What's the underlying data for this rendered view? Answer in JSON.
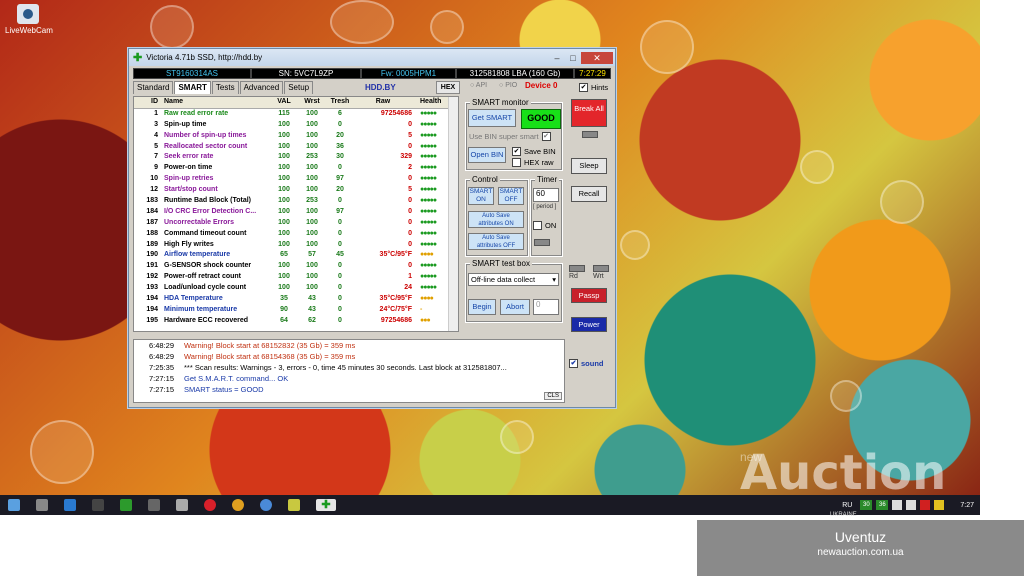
{
  "desktop": {
    "icon_label": "LiveWebCam"
  },
  "window": {
    "title": "Victoria 4.71b SSD, http://hdd.by",
    "min": "–",
    "max": "□",
    "close": "✕"
  },
  "infobar": {
    "model": "ST9160314AS",
    "sn": "SN: 5VC7L9ZP",
    "fw": "Fw: 0005HPM1",
    "lba": "312581808 LBA (160 Gb)",
    "time": "7:27:29"
  },
  "tabs": [
    "Standard",
    "SMART",
    "Tests",
    "Advanced",
    "Setup"
  ],
  "hddby": "HDD.BY",
  "hex_label": "HEX",
  "table": {
    "headers": [
      "ID",
      "Name",
      "VAL",
      "Wrst",
      "Tresh",
      "Raw",
      "Health"
    ],
    "rows": [
      [
        "1",
        "Raw read error rate",
        "115",
        "100",
        "6",
        "97254686",
        "●●●●●",
        "#1a8a1a"
      ],
      [
        "3",
        "Spin-up time",
        "100",
        "100",
        "0",
        "0",
        "●●●●●",
        "#000"
      ],
      [
        "4",
        "Number of spin-up times",
        "100",
        "100",
        "20",
        "5",
        "●●●●●",
        "#8a1a9a"
      ],
      [
        "5",
        "Reallocated sector count",
        "100",
        "100",
        "36",
        "0",
        "●●●●●",
        "#8a1a9a"
      ],
      [
        "7",
        "Seek error rate",
        "100",
        "253",
        "30",
        "329",
        "●●●●●",
        "#8a1a9a"
      ],
      [
        "9",
        "Power-on time",
        "100",
        "100",
        "0",
        "2",
        "●●●●●",
        "#000"
      ],
      [
        "10",
        "Spin-up retries",
        "100",
        "100",
        "97",
        "0",
        "●●●●●",
        "#8a1a9a"
      ],
      [
        "12",
        "Start/stop count",
        "100",
        "100",
        "20",
        "5",
        "●●●●●",
        "#8a1a9a"
      ],
      [
        "183",
        "Runtime Bad Block (Total)",
        "100",
        "253",
        "0",
        "0",
        "●●●●●",
        "#000"
      ],
      [
        "184",
        "I/O CRC Error Detection C...",
        "100",
        "100",
        "97",
        "0",
        "●●●●●",
        "#8a1a9a"
      ],
      [
        "187",
        "Uncorrectable Errors",
        "100",
        "100",
        "0",
        "0",
        "●●●●●",
        "#8a1a9a"
      ],
      [
        "188",
        "Command timeout count",
        "100",
        "100",
        "0",
        "0",
        "●●●●●",
        "#000"
      ],
      [
        "189",
        "High Fly writes",
        "100",
        "100",
        "0",
        "0",
        "●●●●●",
        "#000"
      ],
      [
        "190",
        "Airflow temperature",
        "65",
        "57",
        "45",
        "35°C/95°F",
        "●●●●",
        "#1a3aa8"
      ],
      [
        "191",
        "G-SENSOR shock counter",
        "100",
        "100",
        "0",
        "0",
        "●●●●●",
        "#000"
      ],
      [
        "192",
        "Power-off retract count",
        "100",
        "100",
        "0",
        "1",
        "●●●●●",
        "#000"
      ],
      [
        "193",
        "Load/unload cycle count",
        "100",
        "100",
        "0",
        "24",
        "●●●●●",
        "#000"
      ],
      [
        "194",
        "HDA Temperature",
        "35",
        "43",
        "0",
        "35°C/95°F",
        "●●●●",
        "#1a3aa8"
      ],
      [
        "194",
        "Minimum temperature",
        "90",
        "43",
        "0",
        "24°C/75°F",
        "-",
        "#1a3aa8"
      ],
      [
        "195",
        "Hardware ECC recovered",
        "64",
        "62",
        "0",
        "97254686",
        "●●●",
        "#000"
      ]
    ]
  },
  "log": [
    [
      "6:48:29",
      "Warning! Block start at 68152832 (35 Gb)  = 359 ms",
      "#c03010"
    ],
    [
      "6:48:29",
      "Warning! Block start at 68154368 (35 Gb)  = 359 ms",
      "#c03010"
    ],
    [
      "7:25:35",
      "*** Scan results: Warnings - 3, errors - 0, time 45 minutes 30 seconds. Last block at 312581807...",
      "#000"
    ],
    [
      "7:27:15",
      "Get S.M.A.R.T. command... OK",
      "#1a3aa8"
    ],
    [
      "7:27:15",
      "SMART status = GOOD",
      "#1a3aa8"
    ]
  ],
  "cls": "CLS",
  "right": {
    "api": "API",
    "pio": "PIO",
    "device": "Device 0",
    "hints": "Hints",
    "smart_monitor": "SMART monitor",
    "get_smart": "Get SMART",
    "good": "GOOD",
    "use_bin": "Use BIN super smart",
    "open_bin": "Open BIN",
    "save_bin": "Save BIN",
    "hex_raw": "HEX raw",
    "control": "Control",
    "timer": "Timer",
    "smart_on": "SMART ON",
    "smart_off": "SMART OFF",
    "timer_value": "60",
    "period": "[ period ]",
    "autosave_on": "Auto Save attributes ON",
    "autosave_off": "Auto Save attributes OFF",
    "on": "ON",
    "test_box": "SMART test box",
    "test_select": "Off-line data collect",
    "begin": "Begin",
    "abort": "Abort",
    "test_field": "0",
    "break_all": "Break All",
    "sleep": "Sleep",
    "recall": "Recall",
    "rd": "Rd",
    "wrt": "Wrt",
    "passp": "Passp",
    "power": "Power",
    "sound": "sound"
  },
  "tray": {
    "lang": "RU",
    "time": "7:27",
    "badge1": "30",
    "badge2": "36"
  },
  "watermark": {
    "brand": "Auction",
    "small": "new",
    "name": "Uventuz",
    "site": "newauction.com.ua",
    "caption": "UKRAINE"
  }
}
